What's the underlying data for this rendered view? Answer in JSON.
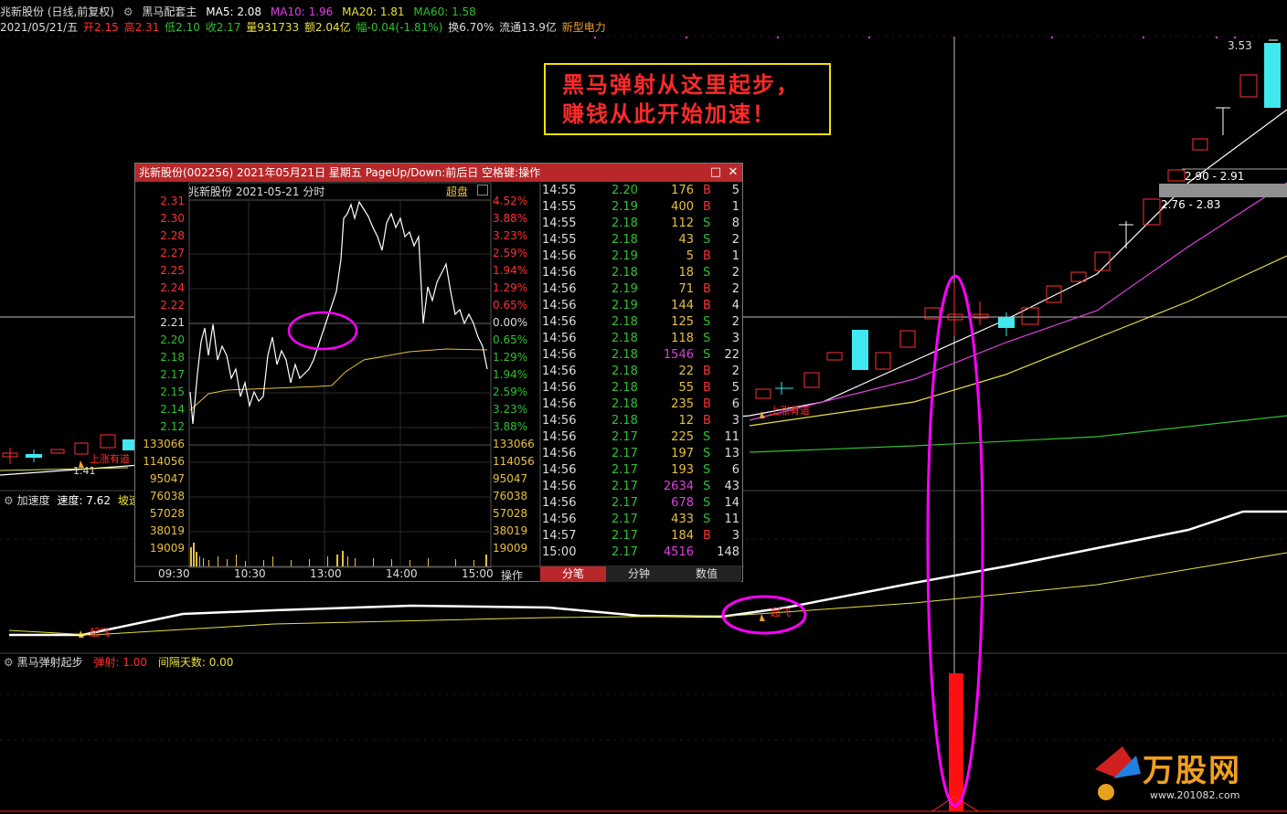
{
  "header": {
    "stock_name": "兆新股份 (日线,前复权)",
    "indicator_name": "黑马配套主",
    "ma5": "MA5: 2.08",
    "ma10": "MA10: 1.96",
    "ma20": "MA20: 1.81",
    "ma60": "MA60: 1.58",
    "date": "2021/05/21/五",
    "open": "开2.15",
    "high": "高2.31",
    "low": "低2.10",
    "close": "收2.17",
    "volume": "量931733",
    "amount": "额2.04亿",
    "change": "幅-0.04(-1.81%)",
    "turnover": "换6.70%",
    "float": "流通13.9亿",
    "sector": "新型电力"
  },
  "callout": {
    "line1": "黑马弹射从这里起步，",
    "line2": "赚钱从此开始加速！"
  },
  "price_labels": {
    "high_mark": "3.53",
    "box1": "2.90 - 2.91",
    "box2": "2.76 - 2.83",
    "low_mark": "1.41",
    "signal_left": "上涨有道",
    "signal_mid": "上涨有道"
  },
  "indicator1": {
    "name": "加速度",
    "speed": "速度: 7.62",
    "slope": "坡速:",
    "signal_left": "起飞",
    "signal_mid": "起飞"
  },
  "indicator2": {
    "name": "黑马弹射起步",
    "launch": "弹射: 1.00",
    "interval": "间隔天数: 0.00"
  },
  "popup": {
    "title": "兆新股份(002256) 2021年05月21日 星期五 PageUp/Down:前后日 空格键:操作",
    "chart_title": "兆新股份  2021-05-21 分时",
    "super": "超盘",
    "op_label": "操作",
    "tabs": [
      "分笔",
      "分钟",
      "数值"
    ],
    "price_ticks": [
      "2.31",
      "2.30",
      "2.28",
      "2.27",
      "2.25",
      "2.24",
      "2.22",
      "2.21",
      "2.20",
      "2.18",
      "2.17",
      "2.15",
      "2.14",
      "2.12"
    ],
    "pct_ticks": [
      "4.52%",
      "3.88%",
      "3.23%",
      "2.59%",
      "1.94%",
      "1.29%",
      "0.65%",
      "0.00%",
      "0.65%",
      "1.29%",
      "1.94%",
      "2.59%",
      "3.23%",
      "3.88%"
    ],
    "vol_ticks": [
      "133066",
      "114056",
      "95047",
      "76038",
      "57028",
      "38019",
      "19009"
    ],
    "time_ticks": [
      "09:30",
      "10:30",
      "13:00",
      "14:00",
      "15:00"
    ],
    "ticks": [
      {
        "t": "14:55",
        "p": "2.20",
        "v": "176",
        "d": "B",
        "n": "5"
      },
      {
        "t": "14:55",
        "p": "2.19",
        "v": "400",
        "d": "B",
        "n": "1"
      },
      {
        "t": "14:55",
        "p": "2.18",
        "v": "112",
        "d": "S",
        "n": "8"
      },
      {
        "t": "14:55",
        "p": "2.18",
        "v": "43",
        "d": "S",
        "n": "2"
      },
      {
        "t": "14:56",
        "p": "2.19",
        "v": "5",
        "d": "B",
        "n": "1"
      },
      {
        "t": "14:56",
        "p": "2.18",
        "v": "18",
        "d": "S",
        "n": "2"
      },
      {
        "t": "14:56",
        "p": "2.19",
        "v": "71",
        "d": "B",
        "n": "2"
      },
      {
        "t": "14:56",
        "p": "2.19",
        "v": "144",
        "d": "B",
        "n": "4"
      },
      {
        "t": "14:56",
        "p": "2.18",
        "v": "125",
        "d": "S",
        "n": "2"
      },
      {
        "t": "14:56",
        "p": "2.18",
        "v": "118",
        "d": "S",
        "n": "3"
      },
      {
        "t": "14:56",
        "p": "2.18",
        "v": "1546",
        "d": "S",
        "n": "22"
      },
      {
        "t": "14:56",
        "p": "2.18",
        "v": "22",
        "d": "B",
        "n": "2"
      },
      {
        "t": "14:56",
        "p": "2.18",
        "v": "55",
        "d": "B",
        "n": "5"
      },
      {
        "t": "14:56",
        "p": "2.18",
        "v": "235",
        "d": "B",
        "n": "6"
      },
      {
        "t": "14:56",
        "p": "2.18",
        "v": "12",
        "d": "B",
        "n": "3"
      },
      {
        "t": "14:56",
        "p": "2.17",
        "v": "225",
        "d": "S",
        "n": "11"
      },
      {
        "t": "14:56",
        "p": "2.17",
        "v": "197",
        "d": "S",
        "n": "13"
      },
      {
        "t": "14:56",
        "p": "2.17",
        "v": "193",
        "d": "S",
        "n": "6"
      },
      {
        "t": "14:56",
        "p": "2.17",
        "v": "2634",
        "d": "S",
        "n": "43"
      },
      {
        "t": "14:56",
        "p": "2.17",
        "v": "678",
        "d": "S",
        "n": "14"
      },
      {
        "t": "14:56",
        "p": "2.17",
        "v": "433",
        "d": "S",
        "n": "11"
      },
      {
        "t": "14:57",
        "p": "2.17",
        "v": "184",
        "d": "B",
        "n": "3"
      },
      {
        "t": "15:00",
        "p": "2.17",
        "v": "4516",
        "d": "",
        "n": "148"
      }
    ]
  },
  "watermark": {
    "brand": "万股网",
    "url": "www.201082.com"
  },
  "colors": {
    "up": "#ff3030",
    "down": "#40e8f0",
    "ma5": "#ffffff",
    "ma10": "#e040e0",
    "ma20": "#e8e040",
    "ma60": "#30c030",
    "highlight": "#ff00ff"
  }
}
